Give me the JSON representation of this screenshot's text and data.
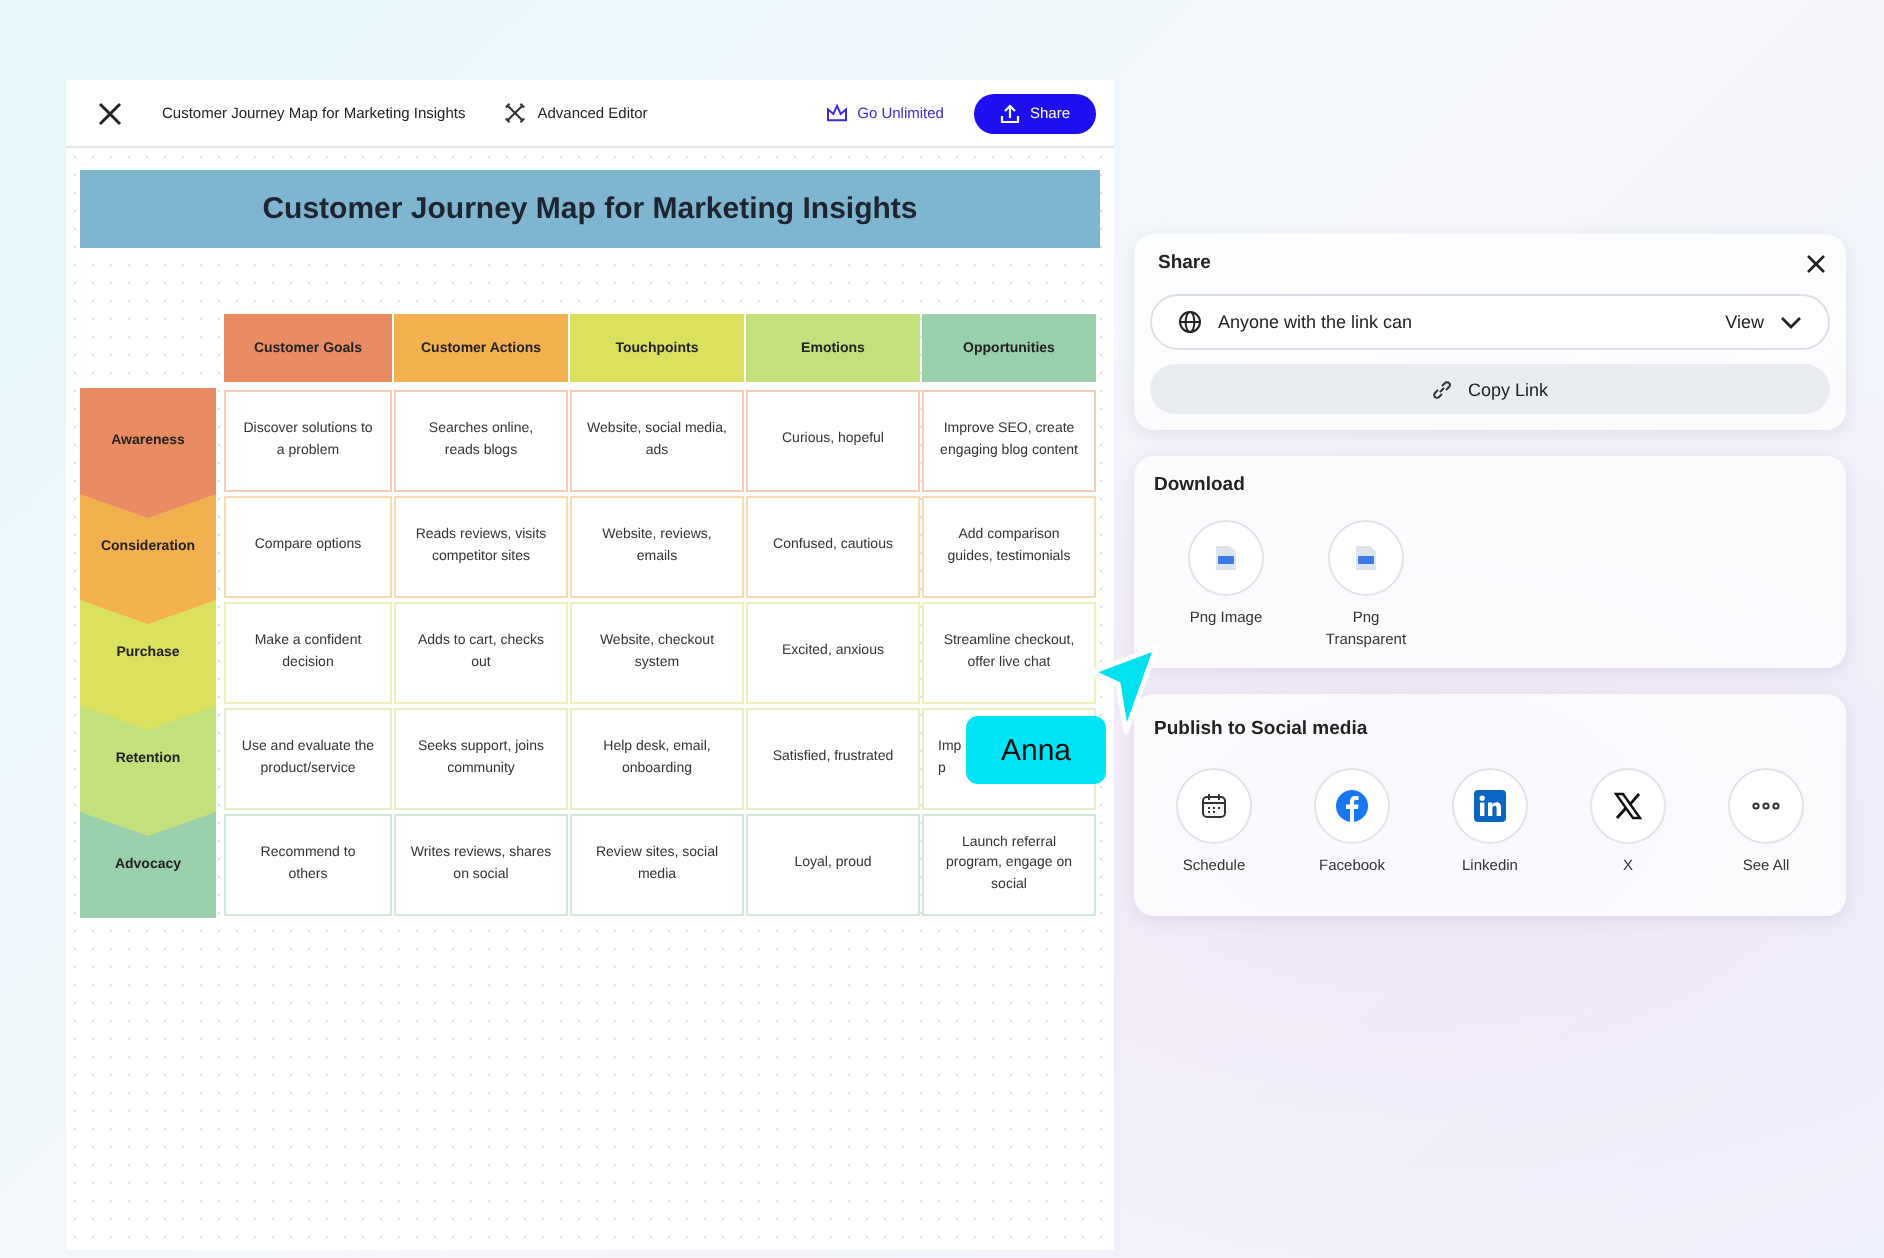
{
  "topbar": {
    "document_title": "Customer Journey Map for Marketing Insights",
    "advanced_editor": "Advanced Editor",
    "upgrade": "Go Unlimited",
    "share_button": "Share"
  },
  "map": {
    "title": "Customer Journey Map for Marketing Insights",
    "columns": [
      {
        "label": "Customer Goals",
        "color": "#e98c64"
      },
      {
        "label": "Customer Actions",
        "color": "#f3b04f"
      },
      {
        "label": "Touchpoints",
        "color": "#dbe05f"
      },
      {
        "label": "Emotions",
        "color": "#c2e07c"
      },
      {
        "label": "Opportunities",
        "color": "#99cfa9"
      }
    ],
    "rows": [
      {
        "label": "Awareness",
        "color": "#e98c64",
        "cells": [
          {
            "text": "Discover solutions to a problem",
            "covered": false
          },
          {
            "text": "Searches online, reads blogs",
            "covered": false
          },
          {
            "text": "Website, social media, ads",
            "covered": false
          },
          {
            "text": "Curious, hopeful",
            "covered": false
          },
          {
            "text": "Improve SEO, create engaging blog content",
            "covered": false
          }
        ]
      },
      {
        "label": "Consideration",
        "color": "#f3b04f",
        "cells": [
          {
            "text": "Compare options",
            "covered": false
          },
          {
            "text": "Reads reviews, visits competitor sites",
            "covered": false
          },
          {
            "text": "Website, reviews, emails",
            "covered": false
          },
          {
            "text": "Confused, cautious",
            "covered": false
          },
          {
            "text": "Add comparison guides, testimonials",
            "covered": false
          }
        ]
      },
      {
        "label": "Purchase",
        "color": "#dbe05f",
        "cells": [
          {
            "text": "Make a confident decision",
            "covered": false
          },
          {
            "text": "Adds to cart, checks out",
            "covered": false
          },
          {
            "text": "Website, checkout system",
            "covered": false
          },
          {
            "text": "Excited, anxious",
            "covered": false
          },
          {
            "text": "Streamline checkout, offer live chat",
            "covered": false
          }
        ]
      },
      {
        "label": "Retention",
        "color": "#c2e07c",
        "cells": [
          {
            "text": "Use and evaluate the product/service",
            "covered": false
          },
          {
            "text": "Seeks support, joins community",
            "covered": false
          },
          {
            "text": "Help desk, email, onboarding",
            "covered": false
          },
          {
            "text": "Satisfied, frustrated",
            "covered": false
          },
          {
            "text": "Imp\np",
            "covered": true
          }
        ]
      },
      {
        "label": "Advocacy",
        "color": "#99cfa9",
        "cells": [
          {
            "text": "Recommend to others",
            "covered": false
          },
          {
            "text": "Writes reviews, shares on social",
            "covered": false
          },
          {
            "text": "Review sites, social media",
            "covered": false
          },
          {
            "text": "Loyal, proud",
            "covered": false
          },
          {
            "text": "Launch referral program, engage on social",
            "covered": false
          }
        ]
      }
    ]
  },
  "cursor": {
    "name": "Anna"
  },
  "share_panel": {
    "title": "Share",
    "access": "Anyone with the link can",
    "permission": "View",
    "copy_link": "Copy Link"
  },
  "download_panel": {
    "title": "Download",
    "options": [
      {
        "label": "Png Image"
      },
      {
        "label": "Png Transparent"
      }
    ]
  },
  "social_panel": {
    "title": "Publish to Social media",
    "options": [
      {
        "kind": "schedule",
        "label": "Schedule"
      },
      {
        "kind": "facebook",
        "label": "Facebook"
      },
      {
        "kind": "linkedin",
        "label": "Linkedin"
      },
      {
        "kind": "x",
        "label": "X"
      },
      {
        "kind": "more",
        "label": "See All"
      }
    ]
  }
}
